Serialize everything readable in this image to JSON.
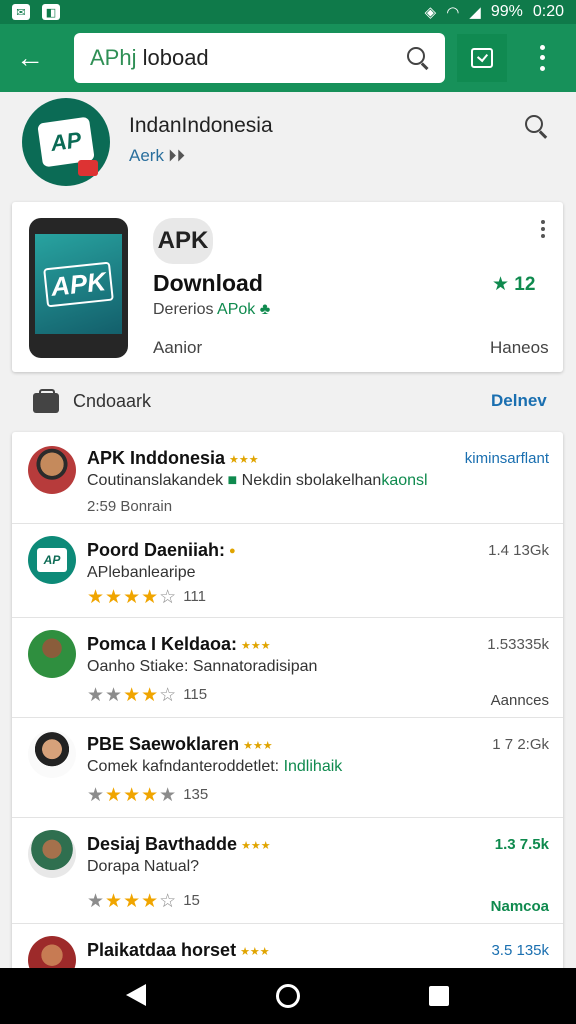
{
  "status_bar": {
    "battery": "99%",
    "time": "0:20",
    "wifi_icon": "wifi-icon",
    "signal_icon": "signal-icon"
  },
  "toolbar": {
    "search_query_a": "APhj",
    "search_query_b": " loboad",
    "back_icon": "arrow-left-icon",
    "accent": "#17915a"
  },
  "header": {
    "title": "IndanIndonesia",
    "subtitle": "Aerk"
  },
  "featured": {
    "badge": "APK",
    "title": "Download",
    "subtitle_a": "Dererios ",
    "subtitle_b": "APok",
    "rating": "★ 12",
    "footer_left": "Aanior",
    "footer_right": "Haneos"
  },
  "section": {
    "label": "Cndoaark",
    "action": "Delnev"
  },
  "list": [
    {
      "name": "APK Inddonesia",
      "desc_a": "Coutinanslakandek ",
      "desc_b": "Nekdin sbolakelhan",
      "desc_c": "kaonsl",
      "meta": "2:59 Bonrain",
      "right_top": "kiminsarflant"
    },
    {
      "name": "Poord Daeniiah:",
      "desc": "APlebanlearipe",
      "rating_count": "111",
      "right_top": "1.4 13Gk"
    },
    {
      "name": "Pomca I Keldaoa:",
      "desc": "Oanho Stiake: Sannatoradisipan",
      "rating_count": "115",
      "right_top": "1.53335k",
      "right_bot": "Aannces"
    },
    {
      "name": "PBE Saewoklaren",
      "desc_a": "Comek kafndanteroddetlet: ",
      "desc_b": "Indlihaik",
      "rating_count": "135",
      "right_top": "1 7 2:Gk"
    },
    {
      "name": "Desiaj Bavthadde",
      "desc": "Dorapa Natual?",
      "rating_count": "15",
      "right_top": "1.3 7.5k",
      "right_bot": "Namcoa"
    },
    {
      "name": "Plaikatdaa horset",
      "right_top": "3.5 135k"
    }
  ]
}
